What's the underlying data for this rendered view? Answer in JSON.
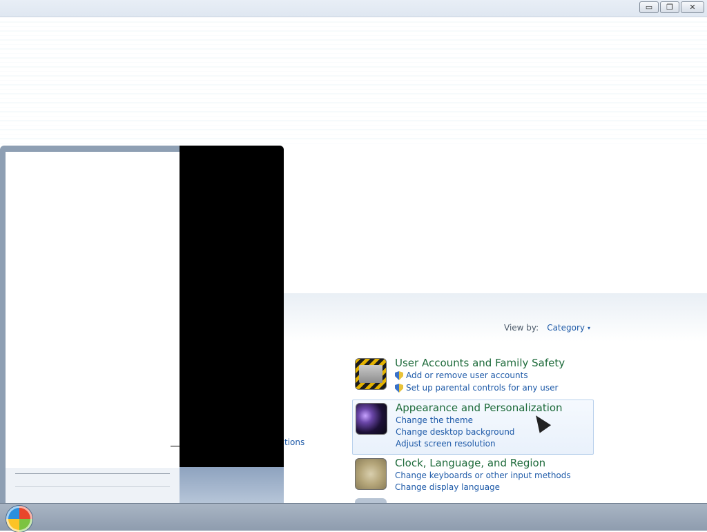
{
  "window": {
    "controls": {
      "minimize": "▭",
      "restore": "❐",
      "close": "✕"
    }
  },
  "view_by": {
    "label": "View by:",
    "value": "Category",
    "arrow_icon": "▾"
  },
  "partial_link": "tions",
  "categories": [
    {
      "title": "User Accounts and Family Safety",
      "icon": "user-accounts-icon",
      "links": [
        {
          "text": "Add or remove user accounts",
          "shield": true
        },
        {
          "text": "Set up parental controls for any user",
          "shield": true
        }
      ]
    },
    {
      "title": "Appearance and Personalization",
      "icon": "appearance-icon",
      "links": [
        {
          "text": "Change the theme",
          "shield": false
        },
        {
          "text": "Change desktop background",
          "shield": false
        },
        {
          "text": "Adjust screen resolution",
          "shield": false
        }
      ]
    },
    {
      "title": "Clock, Language, and Region",
      "icon": "clock-language-icon",
      "links": [
        {
          "text": "Change keyboards or other input methods",
          "shield": false
        },
        {
          "text": "Change display language",
          "shield": false
        }
      ]
    }
  ],
  "colors": {
    "link": "#1e5aa8",
    "category_title": "#1d6a3a",
    "taskbar": "#8e9cae",
    "start_menu_right": "#000000"
  }
}
